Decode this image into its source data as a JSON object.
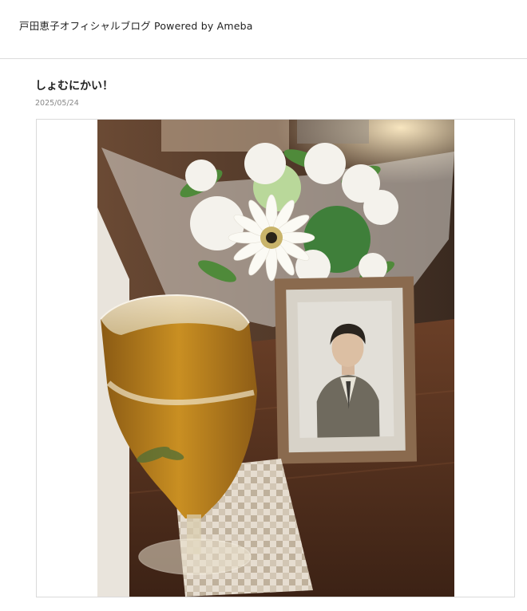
{
  "header": {
    "site_title": "戸田恵子オフィシャルブログ Powered by Ameba"
  },
  "entry": {
    "title": "しょむにかい！",
    "date": "2025/05/24"
  }
}
